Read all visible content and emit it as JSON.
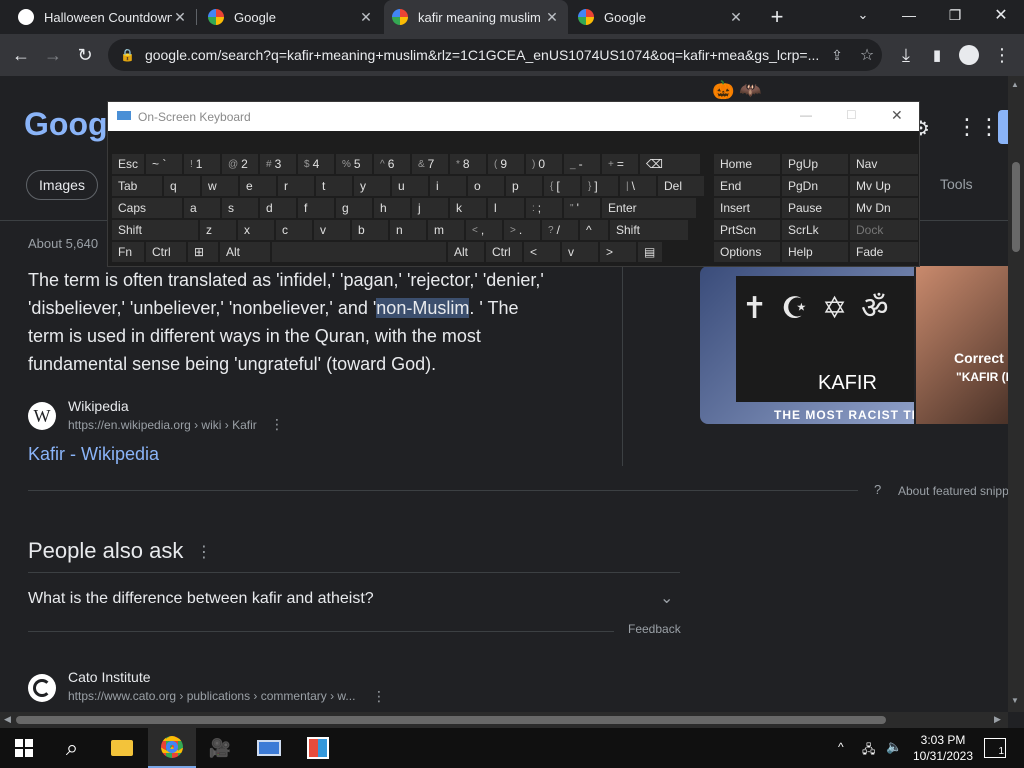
{
  "tabs": [
    {
      "title": "Halloween Countdown",
      "active": false
    },
    {
      "title": "Google",
      "active": false
    },
    {
      "title": "kafir meaning muslim - Google",
      "active": true
    },
    {
      "title": "Google",
      "active": false
    }
  ],
  "toolbar": {
    "url": "google.com/search?q=kafir+meaning+muslim&rlz=1C1GCEA_enUS1074US1074&oq=kafir+mea&gs_lcrp=..."
  },
  "search": {
    "logo": "Google",
    "images_tab": "Images",
    "tools": "Tools",
    "results_count": "About 5,640"
  },
  "featured": {
    "line1": "The term is often translated as 'infidel,' 'pagan,' 'rejector,' 'denier,'",
    "line2a": "'disbeliever,' 'unbeliever,' 'nonbeliever,' and '",
    "line2b": "non-Muslim",
    "line2c": ". ' The",
    "line3": "term is used in different ways in the Quran, with the most",
    "line4": "fundamental sense being 'ungrateful' (toward God).",
    "source_name": "Wikipedia",
    "source_url": "https://en.wikipedia.org › wiki › Kafir",
    "link_title": "Kafir - Wikipedia",
    "about": "About featured snippets",
    "image_caption": "KAFIR",
    "image_subcaption": "THE MOST RACIST TE",
    "image2_caption": "Correct",
    "image2_subcaption": "\"KAFIR (I"
  },
  "paa": {
    "heading": "People also ask",
    "question": "What is the difference between kafir and atheist?",
    "feedback": "Feedback"
  },
  "next_result": {
    "name": "Cato Institute",
    "url": "https://www.cato.org › publications › commentary › w..."
  },
  "osk": {
    "title": "On-Screen Keyboard",
    "rows": [
      [
        [
          "Esc",
          ""
        ],
        [
          "~ `",
          ""
        ],
        [
          "1",
          "!"
        ],
        [
          "2",
          "@"
        ],
        [
          "3",
          "#"
        ],
        [
          "4",
          "$"
        ],
        [
          "5",
          "%"
        ],
        [
          "6",
          "^"
        ],
        [
          "7",
          "&"
        ],
        [
          "8",
          "*"
        ],
        [
          "9",
          "("
        ],
        [
          "0",
          ")"
        ],
        [
          "-",
          "_"
        ],
        [
          "=",
          "+"
        ],
        [
          "⌫",
          ""
        ]
      ],
      [
        [
          "Tab",
          ""
        ],
        [
          "q",
          ""
        ],
        [
          "w",
          ""
        ],
        [
          "e",
          ""
        ],
        [
          "r",
          ""
        ],
        [
          "t",
          ""
        ],
        [
          "y",
          ""
        ],
        [
          "u",
          ""
        ],
        [
          "i",
          ""
        ],
        [
          "o",
          ""
        ],
        [
          "p",
          ""
        ],
        [
          "[",
          "{"
        ],
        [
          "]",
          "}"
        ],
        [
          "\\",
          "|"
        ],
        [
          "Del",
          ""
        ]
      ],
      [
        [
          "Caps",
          ""
        ],
        [
          "a",
          ""
        ],
        [
          "s",
          ""
        ],
        [
          "d",
          ""
        ],
        [
          "f",
          ""
        ],
        [
          "g",
          ""
        ],
        [
          "h",
          ""
        ],
        [
          "j",
          ""
        ],
        [
          "k",
          ""
        ],
        [
          "l",
          ""
        ],
        [
          ";",
          ":"
        ],
        [
          "'",
          "\""
        ],
        [
          "Enter",
          ""
        ]
      ],
      [
        [
          "Shift",
          ""
        ],
        [
          "z",
          ""
        ],
        [
          "x",
          ""
        ],
        [
          "c",
          ""
        ],
        [
          "v",
          ""
        ],
        [
          "b",
          ""
        ],
        [
          "n",
          ""
        ],
        [
          "m",
          ""
        ],
        [
          ",",
          "<"
        ],
        [
          ".",
          ">"
        ],
        [
          "/",
          "?"
        ],
        [
          "^",
          ""
        ],
        [
          "Shift",
          ""
        ]
      ],
      [
        [
          "Fn",
          ""
        ],
        [
          "Ctrl",
          ""
        ],
        [
          "⊞",
          ""
        ],
        [
          "Alt",
          ""
        ],
        [
          "",
          ""
        ],
        [
          "Alt",
          ""
        ],
        [
          "Ctrl",
          ""
        ],
        [
          "<",
          ""
        ],
        [
          "v",
          ""
        ],
        [
          ">",
          ""
        ],
        [
          "▤",
          ""
        ]
      ]
    ],
    "right": [
      [
        "Home",
        "PgUp",
        "Nav"
      ],
      [
        "End",
        "PgDn",
        "Mv Up"
      ],
      [
        "Insert",
        "Pause",
        "Mv Dn"
      ],
      [
        "PrtScn",
        "ScrLk",
        "Dock"
      ],
      [
        "Options",
        "Help",
        "Fade"
      ]
    ]
  },
  "taskbar": {
    "time": "3:03 PM",
    "date": "10/31/2023",
    "notif_count": "1"
  },
  "colors": {
    "link": "#8ab4f8",
    "bg": "#202124",
    "highlight": "#3c4f6e"
  }
}
